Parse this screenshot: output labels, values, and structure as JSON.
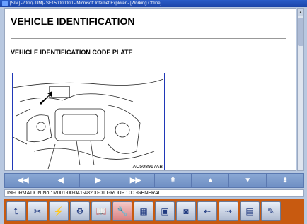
{
  "window": {
    "title": "[S/M] -2007(JDM)- SE150000000 - Microsoft Internet Explorer - [Working Offline]"
  },
  "document": {
    "title": "VEHICLE IDENTIFICATION",
    "section": "VEHICLE IDENTIFICATION CODE PLATE",
    "figure_label": "AC508917AB"
  },
  "nav": {
    "buttons": [
      "◀◀",
      "◀",
      "▶",
      "▶▶",
      "⇞",
      "▲",
      "▼",
      "⇟"
    ]
  },
  "info": {
    "text": "INFORMATION No : M001-00-041-48200-01 GROUP : 00 -GENERAL"
  },
  "toolbar": {
    "icons": [
      "home-icon",
      "tools-icon",
      "flash-icon",
      "parts-icon",
      "manual-icon",
      "wiring-icon",
      "list-icon",
      "screen-icon",
      "camera-icon",
      "left-page-icon",
      "right-page-icon",
      "print-icon",
      "settings-icon"
    ],
    "glyphs": [
      "⮤",
      "✂",
      "⚡",
      "⚙",
      "📖",
      "🔧",
      "▦",
      "▣",
      "◙",
      "⇠",
      "⇢",
      "▤",
      "✎"
    ]
  }
}
